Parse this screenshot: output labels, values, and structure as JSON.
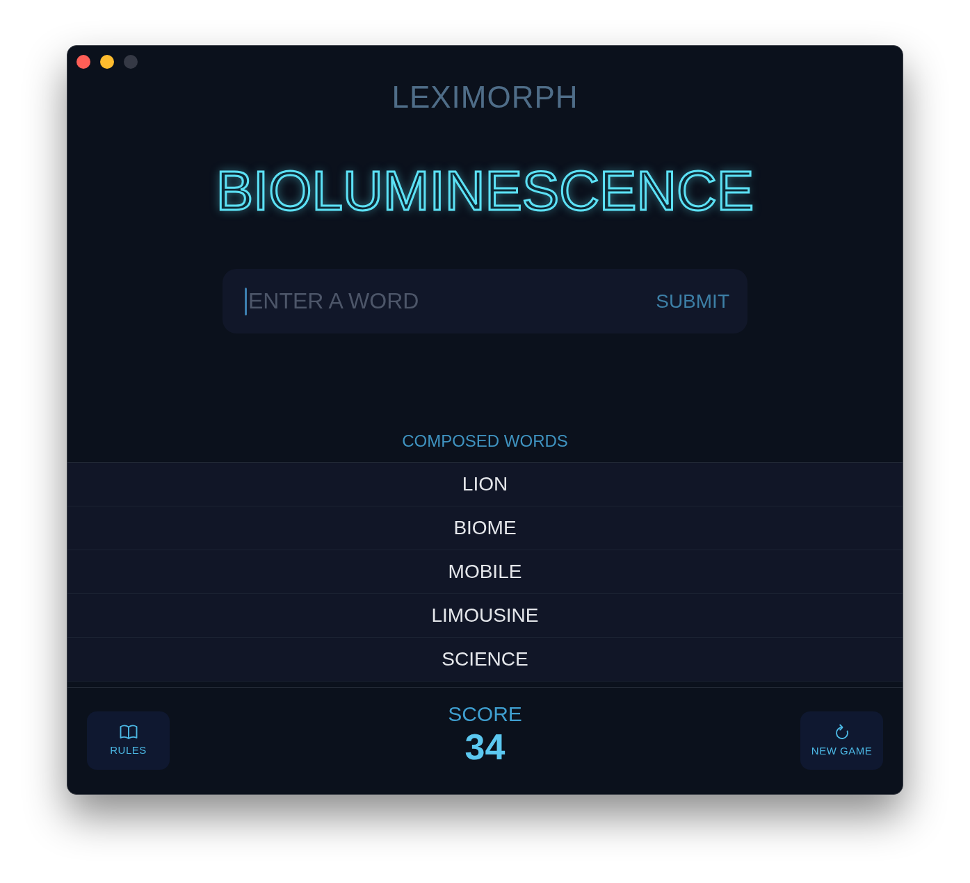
{
  "window": {
    "controls": [
      {
        "color": "#fe5f57"
      },
      {
        "color": "#febc2e"
      },
      {
        "color": "#353945"
      }
    ]
  },
  "app_title": "LEXIMORPH",
  "source_word": "BIOLUMINESCENCE",
  "word_entry": {
    "placeholder": "ENTER A WORD",
    "focused": true,
    "submit": "SUBMIT"
  },
  "composed_words": {
    "heading": "COMPOSED WORDS",
    "items": [
      "LION",
      "BIOME",
      "MOBILE",
      "LIMOUSINE",
      "SCIENCE"
    ]
  },
  "footer": {
    "buttons": [
      {
        "kind": "rules",
        "label": "RULES"
      },
      {
        "kind": "new_game",
        "label": "NEW GAME"
      }
    ],
    "score": {
      "label": "SCORE",
      "value": "34"
    }
  }
}
